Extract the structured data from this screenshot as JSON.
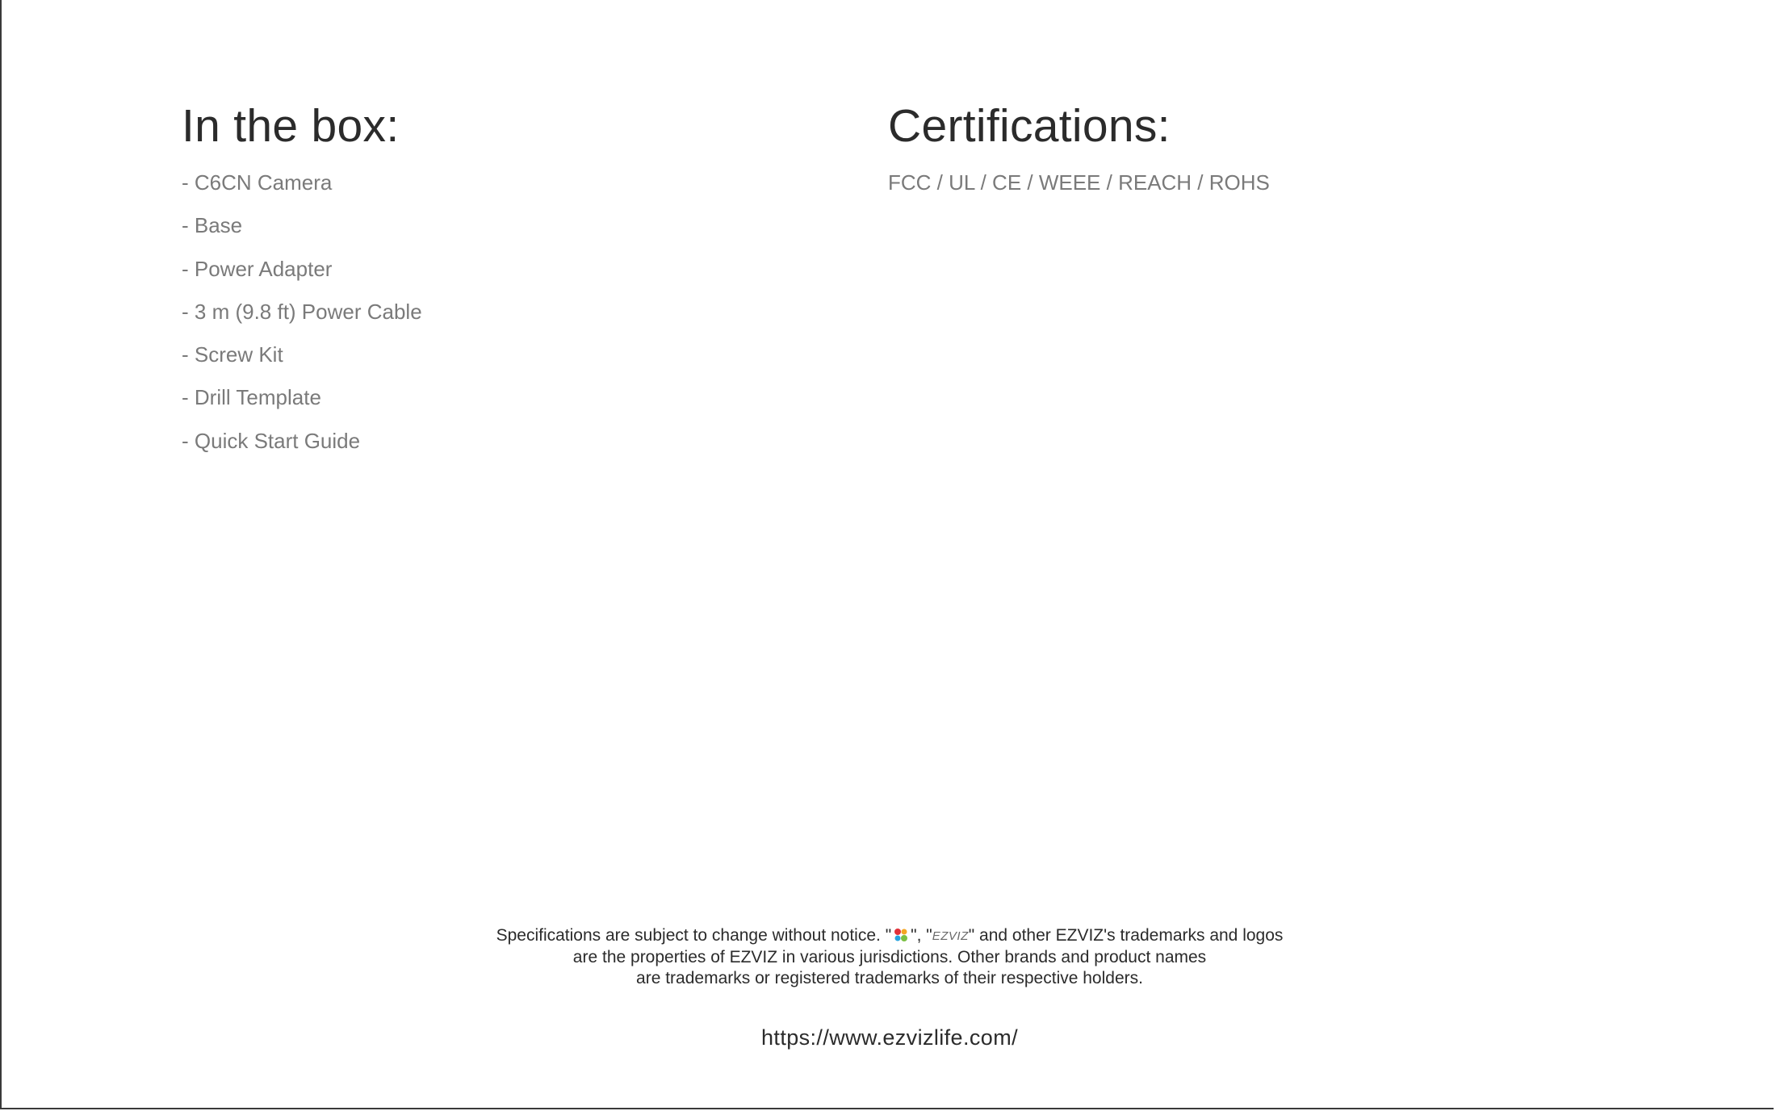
{
  "in_the_box": {
    "title": "In the box:",
    "items": [
      "- C6CN Camera",
      "- Base",
      "- Power Adapter",
      "- 3 m (9.8 ft) Power Cable",
      "- Screw Kit",
      "- Drill Template",
      "- Quick Start Guide"
    ]
  },
  "certifications": {
    "title": "Certifications:",
    "text": "FCC / UL / CE / WEEE / REACH / ROHS"
  },
  "legal": {
    "line1_before": "Specifications are subject to change without notice.  \"",
    "line1_between": "\", \"",
    "wordmark": "EZVIZ",
    "line1_after": "\" and other EZVIZ's trademarks and logos",
    "line2": "are the properties of EZVIZ in various jurisdictions. Other brands and product names",
    "line3": "are trademarks or registered trademarks of their respective holders."
  },
  "footer": {
    "url": "https://www.ezvizlife.com/"
  },
  "colors": {
    "heading": "#2b2b2b",
    "body_text": "#7a7a7a",
    "logo_colors": [
      "#e2313a",
      "#f5a623",
      "#27a3e0",
      "#7bc043"
    ]
  }
}
